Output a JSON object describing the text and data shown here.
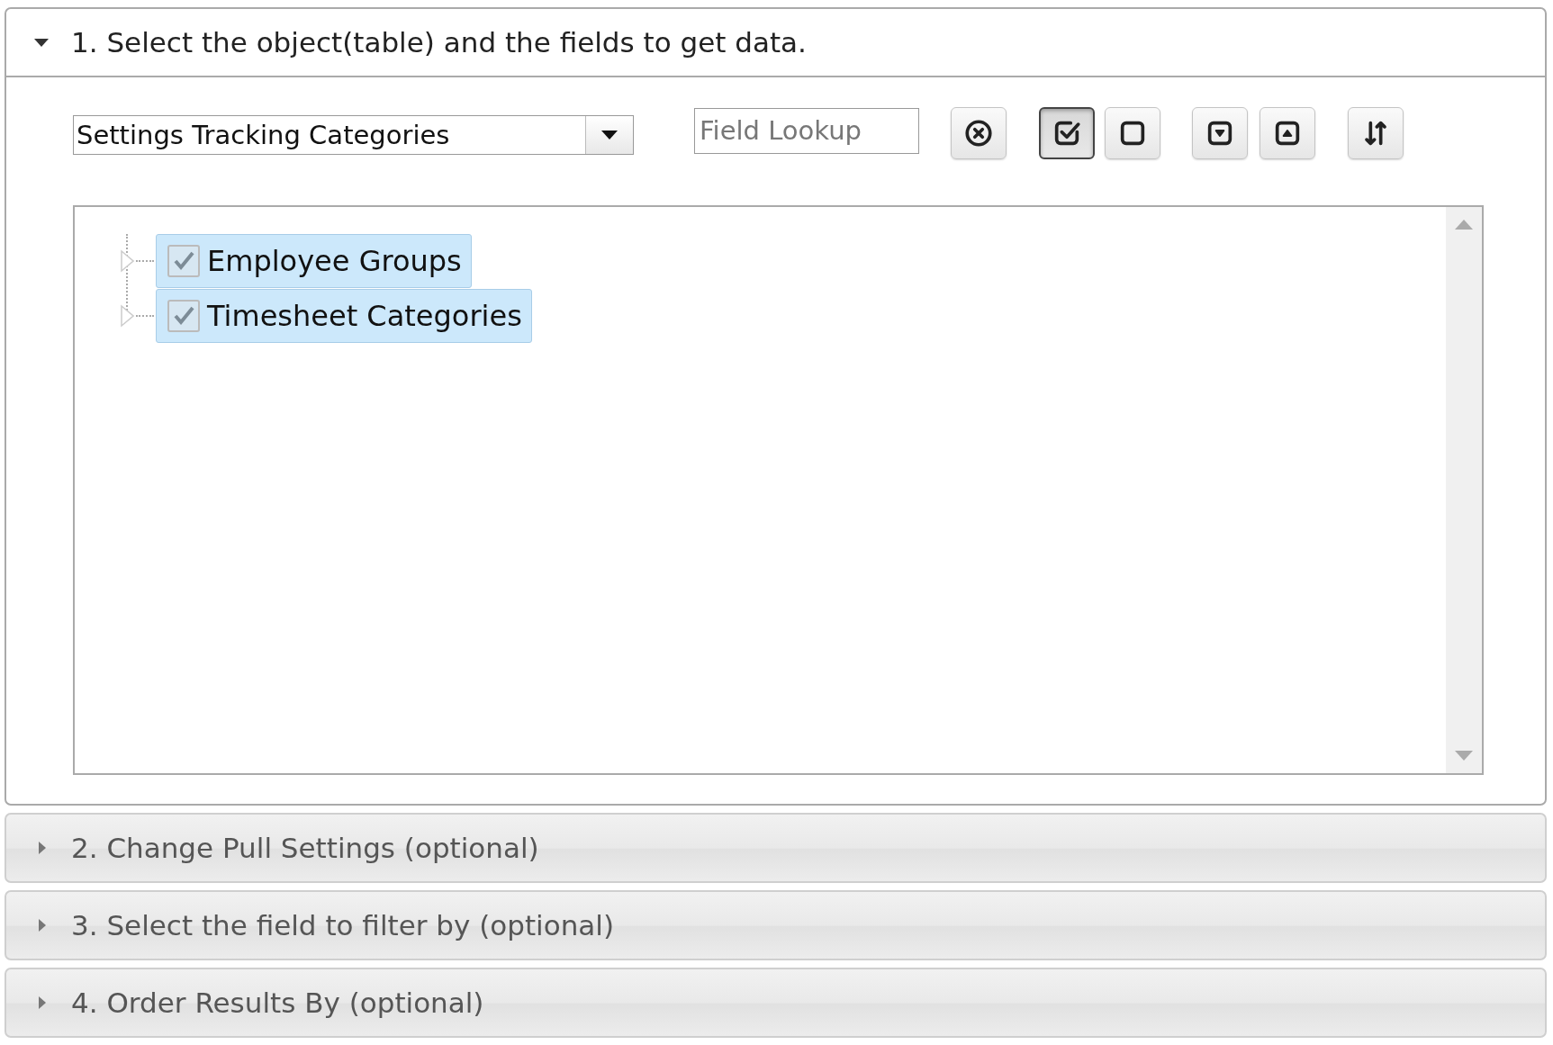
{
  "sections": [
    {
      "title": "1. Select the object(table) and the fields to get data.",
      "expanded": true
    },
    {
      "title": "2. Change Pull Settings (optional)",
      "expanded": false
    },
    {
      "title": "3. Select the field to filter by (optional)",
      "expanded": false
    },
    {
      "title": "4. Order Results By (optional)",
      "expanded": false
    }
  ],
  "object_select": {
    "value": "Settings Tracking Categories"
  },
  "field_lookup": {
    "placeholder": "Field Lookup"
  },
  "toolbar": [
    {
      "kind": "clear",
      "pressed": false
    },
    {
      "kind": "checkall",
      "pressed": true
    },
    {
      "kind": "uncheckall",
      "pressed": false
    },
    {
      "kind": "expand",
      "pressed": false
    },
    {
      "kind": "collapse",
      "pressed": false
    },
    {
      "kind": "sort",
      "pressed": false
    }
  ],
  "tree": {
    "items": [
      {
        "label": "Employee Groups",
        "checked": true,
        "selected": true,
        "expanded": false
      },
      {
        "label": "Timesheet Categories",
        "checked": true,
        "selected": true,
        "expanded": false
      }
    ]
  }
}
